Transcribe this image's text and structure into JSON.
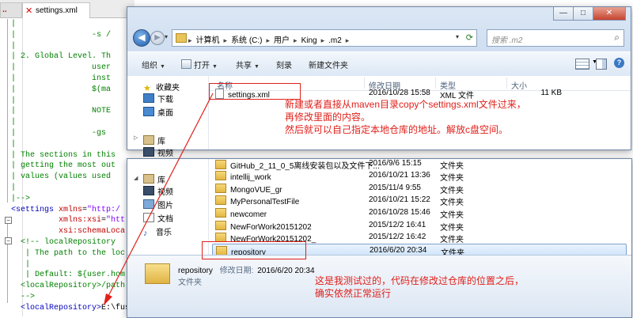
{
  "editor": {
    "tab_prev_label": "..",
    "tab_name": "settings.xml",
    "lines": [
      {
        "parts": [
          [
            "c-com",
            "|"
          ]
        ]
      },
      {
        "parts": [
          [
            "c-com",
            "|                -s /"
          ]
        ]
      },
      {
        "parts": [
          [
            "c-com",
            "|"
          ]
        ]
      },
      {
        "parts": [
          [
            "c-com",
            "| 2. Global Level. Th"
          ]
        ]
      },
      {
        "parts": [
          [
            "c-com",
            "|                user"
          ]
        ]
      },
      {
        "parts": [
          [
            "c-com",
            "|                inst"
          ]
        ]
      },
      {
        "parts": [
          [
            "c-com",
            "|                $(ma"
          ]
        ]
      },
      {
        "parts": [
          [
            "c-com",
            "|"
          ]
        ]
      },
      {
        "parts": [
          [
            "c-com",
            "|                NOTE"
          ]
        ]
      },
      {
        "parts": [
          [
            "c-com",
            "|"
          ]
        ]
      },
      {
        "parts": [
          [
            "c-com",
            "|                -gs"
          ]
        ]
      },
      {
        "parts": [
          [
            "c-com",
            "|"
          ]
        ]
      },
      {
        "parts": [
          [
            "c-com",
            "| The sections in this"
          ]
        ]
      },
      {
        "parts": [
          [
            "c-com",
            "| getting the most out"
          ]
        ]
      },
      {
        "parts": [
          [
            "c-com",
            "| values (values used"
          ]
        ]
      },
      {
        "parts": [
          [
            "c-com",
            "|"
          ]
        ]
      },
      {
        "parts": [
          [
            "c-com",
            "|-->"
          ]
        ]
      },
      {
        "parts": [
          [
            "c-tag",
            "<settings "
          ],
          [
            "c-attr",
            "xmlns"
          ],
          [
            "c-txt",
            "="
          ],
          [
            "c-val",
            "\"http:/"
          ]
        ]
      },
      {
        "parts": [
          [
            "c-attr",
            "          xmlns:xsi"
          ],
          [
            "c-txt",
            "="
          ],
          [
            "c-val",
            "\"htt"
          ]
        ]
      },
      {
        "parts": [
          [
            "c-attr",
            "          xsi:schemaLoca"
          ]
        ]
      },
      {
        "parts": [
          [
            "c-com",
            "  <!-- localRepository"
          ]
        ]
      },
      {
        "parts": [
          [
            "c-com",
            "   | The path to the loc"
          ]
        ]
      },
      {
        "parts": [
          [
            "c-com",
            "   |"
          ]
        ]
      },
      {
        "parts": [
          [
            "c-com",
            "   | Default: ${user.hom"
          ]
        ]
      },
      {
        "parts": [
          [
            "c-com",
            "  <localRepository>/path"
          ]
        ]
      },
      {
        "parts": [
          [
            "c-com",
            "  -->"
          ]
        ]
      },
      {
        "parts": [
          [
            "c-tag",
            "  <localRepository>"
          ],
          [
            "c-txt",
            "E:\\fusion\\repository"
          ],
          [
            "c-tag",
            "</localRepository>"
          ]
        ]
      }
    ]
  },
  "explorer": {
    "nav_back": "◀",
    "nav_fwd": "▶",
    "breadcrumbs": [
      "计算机",
      "系统 (C:)",
      "用户",
      "King",
      ".m2"
    ],
    "search_placeholder": "搜索 .m2",
    "search_icon": "magnifier-icon",
    "toolbar": {
      "organize": "组织",
      "open": "打开",
      "share": "共享",
      "burn": "刻录",
      "new_folder": "新建文件夹"
    },
    "caption": {
      "min": "—",
      "max": "□",
      "close": "✕"
    },
    "sidebar_top": [
      {
        "label": "收藏夹",
        "icon": "star-icon"
      },
      {
        "label": "下载",
        "icon": "download-icon"
      },
      {
        "label": "桌面",
        "icon": "desktop-icon"
      },
      {
        "label": "库",
        "icon": "library-icon"
      },
      {
        "label": "视频",
        "icon": "video-icon"
      }
    ],
    "sidebar_bottom": [
      {
        "label": "库",
        "icon": "library-icon"
      },
      {
        "label": "视频",
        "icon": "video-icon"
      },
      {
        "label": "图片",
        "icon": "pictures-icon"
      },
      {
        "label": "文档",
        "icon": "documents-icon"
      },
      {
        "label": "音乐",
        "icon": "music-icon"
      }
    ],
    "columns": {
      "name": "名称",
      "date": "修改日期",
      "type": "类型",
      "size": "大小"
    },
    "front_files": [
      {
        "name": "settings.xml",
        "date": "2016/10/28 15:58",
        "type": "XML 文件",
        "size": "11 KB",
        "kind": "xml"
      }
    ],
    "back_files": [
      {
        "name": "GitHub_2_11_0_5离线安装包以及文件下...",
        "date": "2016/9/6 15:15",
        "type": "文件夹",
        "size": ""
      },
      {
        "name": "intellij_work",
        "date": "2016/10/21 13:36",
        "type": "文件夹",
        "size": ""
      },
      {
        "name": "MongoVUE_gr",
        "date": "2015/11/4 9:55",
        "type": "文件夹",
        "size": ""
      },
      {
        "name": "MyPersonalTestFile",
        "date": "2016/10/21 15:22",
        "type": "文件夹",
        "size": ""
      },
      {
        "name": "newcomer",
        "date": "2016/10/28 15:46",
        "type": "文件夹",
        "size": ""
      },
      {
        "name": "NewForWork20151202",
        "date": "2015/12/2 16:41",
        "type": "文件夹",
        "size": ""
      },
      {
        "name": "NewForWork20151202_",
        "date": "2015/12/2 16:42",
        "type": "文件夹",
        "size": ""
      },
      {
        "name": "repository",
        "date": "2016/6/20 20:34",
        "type": "文件夹",
        "size": "",
        "selected": true
      }
    ],
    "details": {
      "name": "repository",
      "date_label": "修改日期:",
      "date": "2016/6/20 20:34",
      "type": "文件夹"
    }
  },
  "annotations": {
    "top": [
      "新建或者直接从maven目录copy个settings.xml文件过来，",
      "再修改里面的内容。",
      "然后就可以自己指定本地仓库的地址。解放c盘空间。"
    ],
    "bottom": [
      "这是我测试过的，代码在修改过仓库的位置之后，",
      "确实依然正常运行"
    ],
    "color": "#e0201a"
  }
}
